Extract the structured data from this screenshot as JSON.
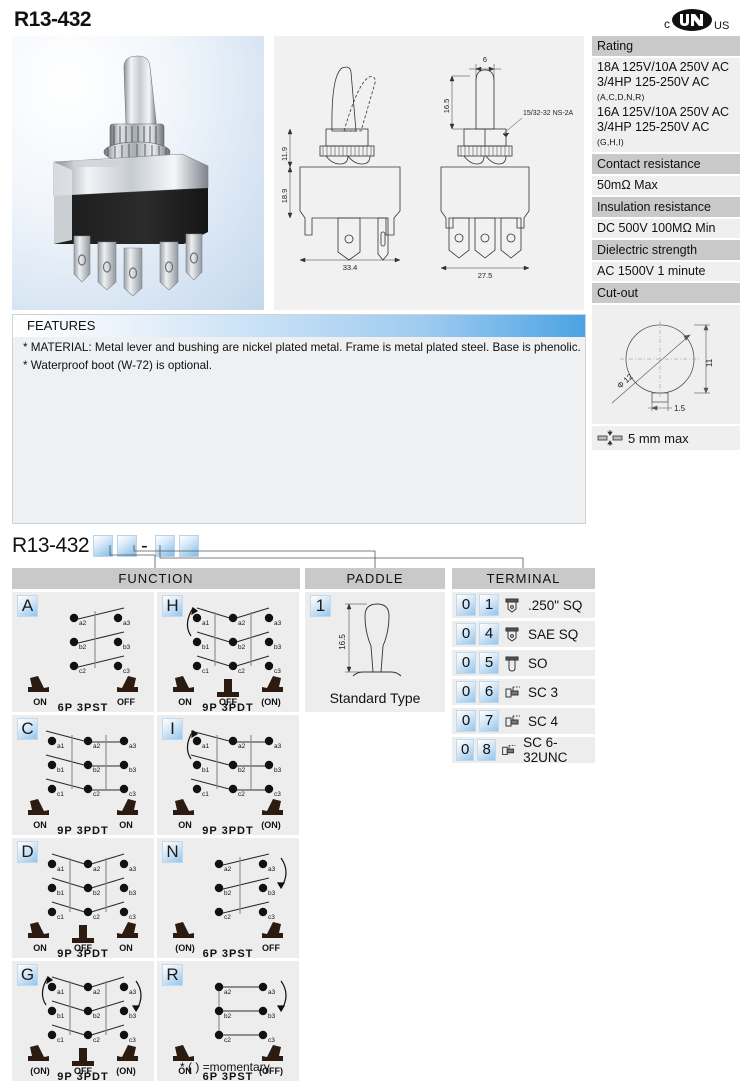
{
  "page_title": "R13-432",
  "certification": {
    "mark": "cULus",
    "left": "c",
    "right": "US"
  },
  "spec": {
    "rows": [
      {
        "header": "Rating",
        "lines": [
          "18A 125V/10A 250V AC",
          "3/4HP 125-250V AC"
        ],
        "small1": "(A,C,D,N,R)",
        "lines2": [
          "16A 125V/10A 250V AC",
          "3/4HP 125-250V AC"
        ],
        "small2": "(G,H,I)"
      },
      {
        "header": "Contact resistance",
        "value": "50mΩ Max"
      },
      {
        "header": "Insulation resistance",
        "value": "DC 500V 100MΩ Min"
      },
      {
        "header": "Dielectric strength",
        "value": "AC 1500V 1 minute"
      },
      {
        "header": "Cut-out"
      }
    ],
    "cutout": {
      "diameter": "Φ 12",
      "height": "11",
      "notch": "1.5"
    },
    "panel_thickness": "5 mm max"
  },
  "drawing": {
    "front": {
      "bushing_height": "11.9",
      "body_height": "18.9",
      "width": "33.4"
    },
    "side": {
      "lever_width": "6",
      "lever_height": "16.5",
      "thread": "15/32-32 NS-2A",
      "width": "27.5"
    }
  },
  "features": {
    "title": "FEATURES",
    "lines": [
      "* MATERIAL: Metal lever and bushing are nickel plated metal. Frame is metal plated steel. Base is phenolic.",
      "* Waterproof boot (W-72) is optional."
    ]
  },
  "ordering": {
    "prefix": "R13-432",
    "dash": "-",
    "boxes": [
      "",
      "",
      "",
      ""
    ]
  },
  "columns": {
    "function": "FUNCTION",
    "paddle": "PADDLE",
    "terminal": "TERMINAL"
  },
  "functions": [
    {
      "code": "A",
      "poles": "6P 3PST",
      "positions": [
        "ON",
        "",
        "OFF"
      ],
      "rows": [
        "a",
        "b",
        "c"
      ],
      "terminals": [
        "a2",
        "a3",
        "b2",
        "b3",
        "c2",
        "c3"
      ],
      "type": "6p",
      "arrows": []
    },
    {
      "code": "H",
      "poles": "9P 3PDT",
      "positions": [
        "ON",
        "OFF",
        "(ON)"
      ],
      "rows": [
        "a",
        "b",
        "c"
      ],
      "terminals": [
        "a1",
        "a2",
        "a3",
        "b1",
        "b2",
        "b3",
        "c1",
        "c2",
        "c3"
      ],
      "type": "9p-v",
      "arrows": [
        "left"
      ]
    },
    {
      "code": "C",
      "poles": "9P 3PDT",
      "positions": [
        "ON",
        "",
        "ON"
      ],
      "rows": [
        "a",
        "b",
        "c"
      ],
      "terminals": [
        "a1",
        "a2",
        "a3",
        "b1",
        "b2",
        "b3",
        "c1",
        "c2",
        "c3"
      ],
      "type": "9p-slant",
      "arrows": []
    },
    {
      "code": "I",
      "poles": "9P 3PDT",
      "positions": [
        "ON",
        "",
        "(ON)"
      ],
      "rows": [
        "a",
        "b",
        "c"
      ],
      "terminals": [
        "a1",
        "a2",
        "a3",
        "b1",
        "b2",
        "b3",
        "c1",
        "c2",
        "c3"
      ],
      "type": "9p-slant",
      "arrows": [
        "left"
      ]
    },
    {
      "code": "D",
      "poles": "9P 3PDT",
      "positions": [
        "ON",
        "OFF",
        "ON"
      ],
      "rows": [
        "a",
        "b",
        "c"
      ],
      "terminals": [
        "a1",
        "a2",
        "a3",
        "b1",
        "b2",
        "b3",
        "c1",
        "c2",
        "c3"
      ],
      "type": "9p-v",
      "arrows": []
    },
    {
      "code": "N",
      "poles": "6P 3PST",
      "positions": [
        "(ON)",
        "",
        "OFF"
      ],
      "rows": [
        "a",
        "b",
        "c"
      ],
      "terminals": [
        "a2",
        "a3",
        "b2",
        "b3",
        "c2",
        "c3"
      ],
      "type": "6p",
      "arrows": [
        "right"
      ]
    },
    {
      "code": "G",
      "poles": "9P 3PDT",
      "positions": [
        "(ON)",
        "OFF",
        "(ON)"
      ],
      "rows": [
        "a",
        "b",
        "c"
      ],
      "terminals": [
        "a1",
        "a2",
        "a3",
        "b1",
        "b2",
        "b3",
        "c1",
        "c2",
        "c3"
      ],
      "type": "9p-v",
      "arrows": [
        "left",
        "right"
      ]
    },
    {
      "code": "R",
      "poles": "6P 3PST",
      "positions": [
        "ON",
        "",
        "(OFF)"
      ],
      "rows": [
        "a",
        "b",
        "c"
      ],
      "terminals": [
        "a2",
        "a3",
        "b2",
        "b3",
        "c2",
        "c3"
      ],
      "type": "6p-flat",
      "arrows": [
        "right"
      ]
    }
  ],
  "momentary_note": "* (  ) =momentary",
  "paddle": {
    "code": "1",
    "dimension": "16.5",
    "caption": "Standard  Type"
  },
  "terminals": [
    {
      "d1": "0",
      "d2": "1",
      "icon": "quick-connect-icon",
      "label": ".250\" SQ"
    },
    {
      "d1": "0",
      "d2": "4",
      "icon": "quick-connect-icon",
      "label": "SAE SQ"
    },
    {
      "d1": "0",
      "d2": "5",
      "icon": "solder-lug-icon",
      "label": "SO"
    },
    {
      "d1": "0",
      "d2": "6",
      "icon": "screw-terminal-icon",
      "label": "SC 3"
    },
    {
      "d1": "0",
      "d2": "7",
      "icon": "screw-terminal-icon",
      "label": "SC 4"
    },
    {
      "d1": "0",
      "d2": "8",
      "icon": "screw-terminal-icon",
      "label": "SC 6-32UNC"
    }
  ],
  "colors": {
    "header_gray": "#c9c9c9",
    "cell_gray": "#ededed",
    "accent_blue": "#4ba3e3",
    "photo_bg": "#c3d8ec"
  }
}
